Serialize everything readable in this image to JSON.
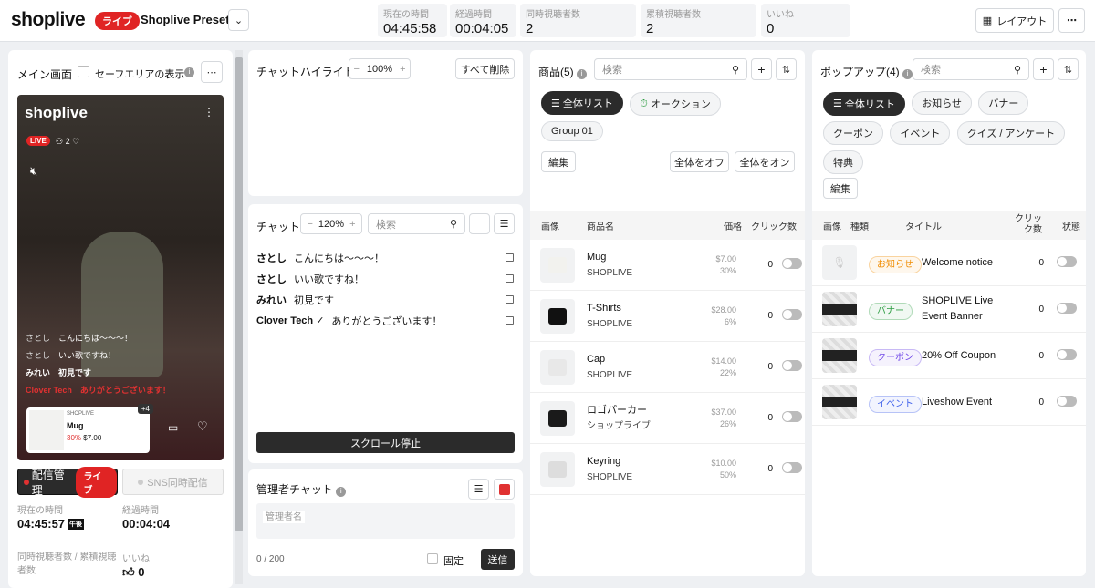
{
  "header": {
    "logo": "shoplive",
    "live_badge": "ライブ",
    "preset": "Shoplive Preset",
    "stats": [
      {
        "label": "現在の時間",
        "value": "04:45:58"
      },
      {
        "label": "経過時間",
        "value": "00:04:05"
      },
      {
        "label": "同時視聴者数",
        "value": "2"
      },
      {
        "label": "累積視聴者数",
        "value": "2"
      },
      {
        "label": "いいね",
        "value": "0"
      }
    ],
    "layout_button": "レイアウト"
  },
  "main": {
    "title": "メイン画面",
    "safe_area": "セーフエリアの表示",
    "video": {
      "logo": "shoplive",
      "live": "LIVE",
      "viewers": "2",
      "chats": [
        {
          "user": "さとし",
          "text": "こんにちは〜〜〜！"
        },
        {
          "user": "さとし",
          "text": "いい歌ですね！"
        },
        {
          "user": "みれい",
          "text": "初見です"
        },
        {
          "user": "Clover Tech",
          "text": "ありがとうございます！"
        }
      ],
      "product": {
        "brand": "SHOPLIVE",
        "name": "Mug",
        "discount": "30%",
        "price": "$7.00",
        "more": "+4"
      }
    },
    "broadcast_button": "配信管理",
    "broadcast_badge": "ライブ",
    "sns_button": "SNS同時配信",
    "current_time_label": "現在の時間",
    "current_time": "04:45:57",
    "ampm": "午後",
    "elapsed_label": "経過時間",
    "elapsed": "00:04:04",
    "viewers_label": "同時視聴者数 / 累積視聴者数",
    "likes_label": "いいね",
    "likes": "0"
  },
  "highlight": {
    "title": "チャットハイライト",
    "zoom": "100%",
    "clear": "すべて削除"
  },
  "chat": {
    "title": "チャット",
    "zoom": "120%",
    "search_placeholder": "検索",
    "messages": [
      {
        "user": "さとし",
        "text": "こんにちは〜〜〜！"
      },
      {
        "user": "さとし",
        "text": "いい歌ですね！"
      },
      {
        "user": "みれい",
        "text": "初見です"
      },
      {
        "user": "Clover Tech ✓",
        "text": "ありがとうございます！"
      }
    ],
    "stop_scroll": "スクロール停止"
  },
  "admin": {
    "title": "管理者チャット",
    "name_placeholder": "管理者名",
    "count": "0 / 200",
    "pin": "固定",
    "send": "送信"
  },
  "products": {
    "title": "商品(5)",
    "search_placeholder": "検索",
    "chips": [
      "全体リスト",
      "オークション",
      "Group 01"
    ],
    "edit": "編集",
    "all_off": "全体をオフ",
    "all_on": "全体をオン",
    "columns": [
      "画像",
      "商品名",
      "価格",
      "クリック数"
    ],
    "items": [
      {
        "name": "Mug",
        "brand": "SHOPLIVE",
        "price": "$7.00",
        "discount": "30%",
        "clicks": "0"
      },
      {
        "name": "T-Shirts",
        "brand": "SHOPLIVE",
        "price": "$28.00",
        "discount": "6%",
        "clicks": "0"
      },
      {
        "name": "Cap",
        "brand": "SHOPLIVE",
        "price": "$14.00",
        "discount": "22%",
        "clicks": "0"
      },
      {
        "name": "ロゴパーカー",
        "brand": "ショップライブ",
        "price": "$37.00",
        "discount": "26%",
        "clicks": "0"
      },
      {
        "name": "Keyring",
        "brand": "SHOPLIVE",
        "price": "$10.00",
        "discount": "50%",
        "clicks": "0"
      }
    ]
  },
  "popups": {
    "title": "ポップアップ(4)",
    "search_placeholder": "検索",
    "chips": [
      "全体リスト",
      "お知らせ",
      "バナー",
      "クーポン",
      "イベント",
      "クイズ / アンケート",
      "特典"
    ],
    "edit": "編集",
    "columns": [
      "画像",
      "種類",
      "タイトル",
      "クリック数",
      "状態"
    ],
    "items": [
      {
        "type": "お知らせ",
        "title": "Welcome notice",
        "clicks": "0",
        "color": "#f08c00"
      },
      {
        "type": "バナー",
        "title": "SHOPLIVE Live Event Banner",
        "clicks": "0",
        "color": "#2f9e44"
      },
      {
        "type": "クーポン",
        "title": "20% Off Coupon",
        "clicks": "0",
        "color": "#7048e8"
      },
      {
        "type": "イベント",
        "title": "Liveshow Event",
        "clicks": "0",
        "color": "#4263eb"
      }
    ]
  }
}
